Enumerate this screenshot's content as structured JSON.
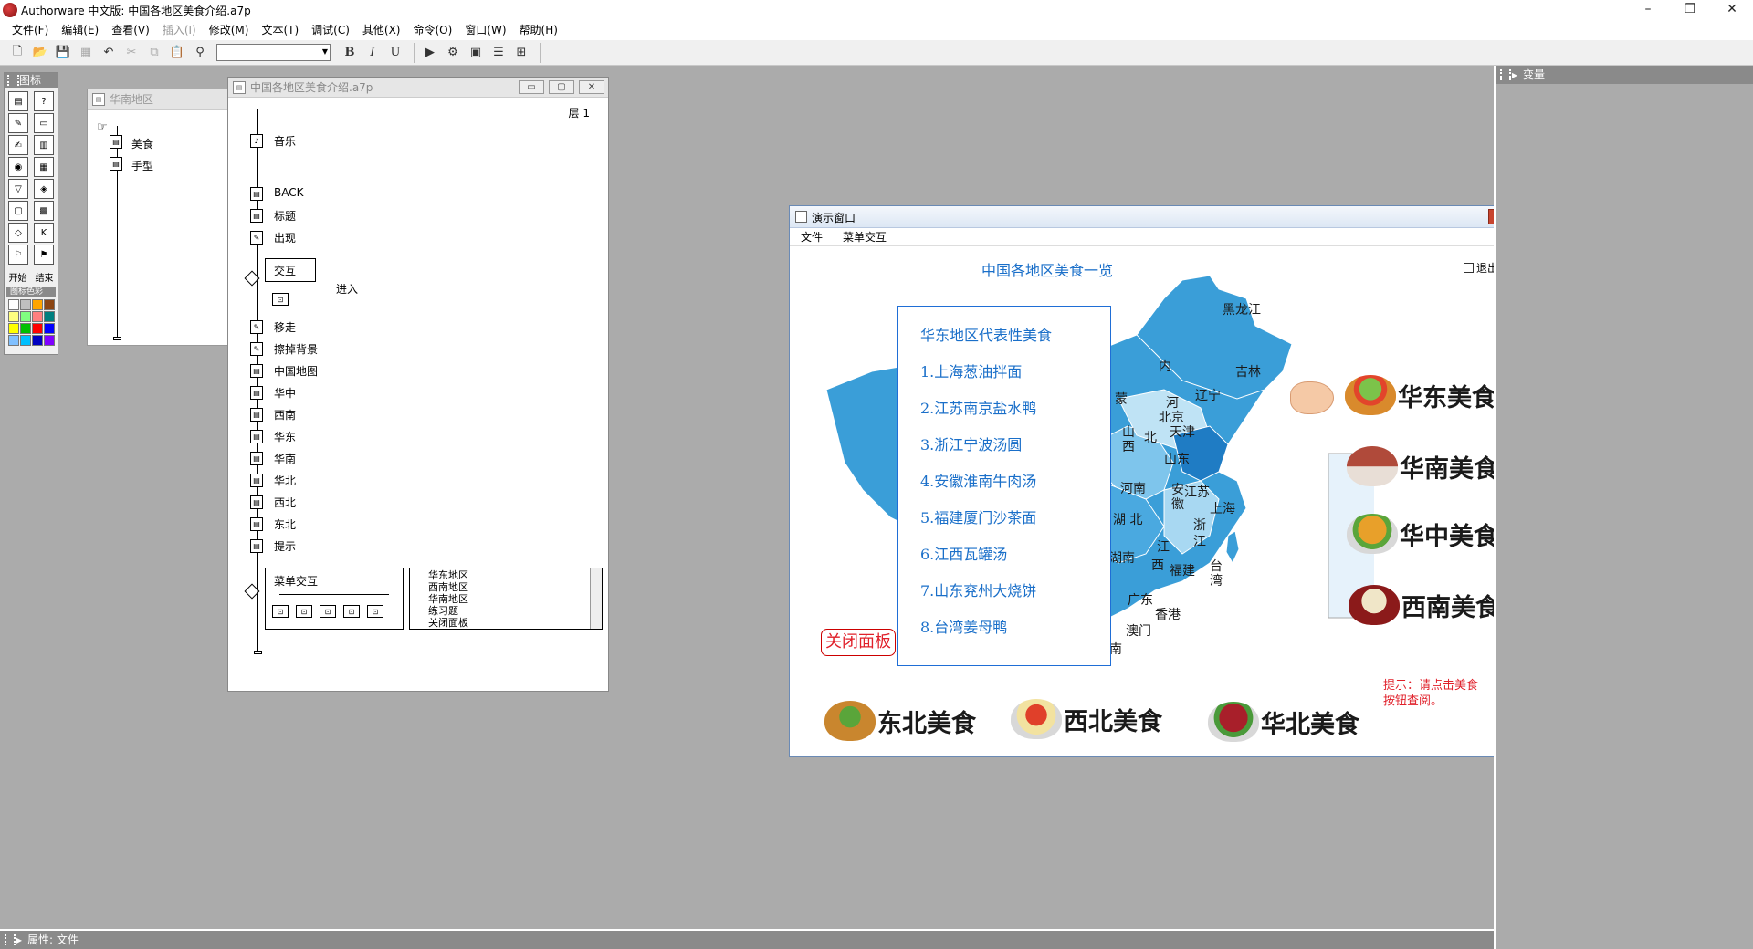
{
  "app": {
    "title": "Authorware 中文版: 中国各地区美食介绍.a7p",
    "window_controls": {
      "minimize": "–",
      "restore": "❐",
      "close": "✕"
    }
  },
  "menubar": [
    {
      "label": "文件(F)",
      "enabled": true
    },
    {
      "label": "编辑(E)",
      "enabled": true
    },
    {
      "label": "查看(V)",
      "enabled": true
    },
    {
      "label": "插入(I)",
      "enabled": false
    },
    {
      "label": "修改(M)",
      "enabled": true
    },
    {
      "label": "文本(T)",
      "enabled": true
    },
    {
      "label": "调试(C)",
      "enabled": true
    },
    {
      "label": "其他(X)",
      "enabled": true
    },
    {
      "label": "命令(O)",
      "enabled": true
    },
    {
      "label": "窗口(W)",
      "enabled": true
    },
    {
      "label": "帮助(H)",
      "enabled": true
    }
  ],
  "toolbar": {
    "font_value": "",
    "bold": "B",
    "italic": "I",
    "underline": "U"
  },
  "palette": {
    "title": "图标",
    "start_label": "开始",
    "end_label": "结束",
    "color_label": "图标色彩",
    "colors": [
      "#ffffff",
      "#c0c0c0",
      "#ffa500",
      "#8b4513",
      "#ffff80",
      "#80ff80",
      "#ff8080",
      "#008080",
      "#ffff00",
      "#00c000",
      "#ff0000",
      "#0000ff",
      "#80c0ff",
      "#00c0ff",
      "#0000c0",
      "#8000ff"
    ]
  },
  "huanan_window": {
    "title": "华南地区",
    "items": [
      "美食",
      "手型"
    ]
  },
  "flow_window": {
    "title": "中国各地区美食介绍.a7p",
    "level_label": "层 1",
    "icons": [
      "音乐",
      "BACK",
      "标题",
      "出现",
      "交互",
      "移走",
      "擦掉背景",
      "中国地图",
      "华中",
      "西南",
      "华东",
      "华南",
      "华北",
      "西北",
      "东北",
      "提示",
      "菜单交互"
    ],
    "branch_label": "进入",
    "list_items": [
      "华东地区",
      "西南地区",
      "华南地区",
      "练习题",
      "关闭面板"
    ]
  },
  "presentation": {
    "title": "演示窗口",
    "menu": [
      "文件",
      "菜单交互"
    ],
    "heading": "中国各地区美食一览",
    "exit_label": "退出",
    "panel": {
      "title": "华东地区代表性美食",
      "items": [
        "1.上海葱油拌面",
        "2.江苏南京盐水鸭",
        "3.浙江宁波汤圆",
        "4.安徽淮南牛肉汤",
        "5.福建厦门沙茶面",
        "6.江西瓦罐汤",
        "7.山东兖州大烧饼",
        "8.台湾姜母鸭"
      ]
    },
    "close_panel": "关闭面板",
    "foods": {
      "huadong": "华东美食",
      "huanan": "华南美食",
      "huazhong": "华中美食",
      "xinan": "西南美食",
      "dongbei": "东北美食",
      "xibei": "西北美食",
      "huabei": "华北美食"
    },
    "hint_line1": "提示：请点击美食",
    "hint_line2": "按钮查阅。",
    "map_labels": {
      "heilongjiang": "黑龙江",
      "jilin": "吉林",
      "liaoning": "辽宁",
      "nei": "内",
      "meng": "蒙",
      "he": "河",
      "beijing": "北京",
      "tianjin": "天津",
      "bei": "北",
      "shan": "山",
      "xi": "西",
      "shandong": "山东",
      "henan": "河南",
      "anhui": "安徽",
      "jiangsu": "江苏",
      "shanghai": "上海",
      "hubei": "湖 北",
      "zhejiang_1": "浙",
      "zhejiang_2": "江",
      "jiangxi_1": "江",
      "jiangxi_2": "西",
      "hunan": "湖南",
      "fujian": "福建",
      "taiwan": "台湾",
      "guangdong": "广东",
      "xianggang": "香港",
      "aomen": "澳门",
      "nan": "南"
    }
  },
  "vars_panel": {
    "title": "变量"
  },
  "props_bar": {
    "title": "属性: 文件"
  }
}
